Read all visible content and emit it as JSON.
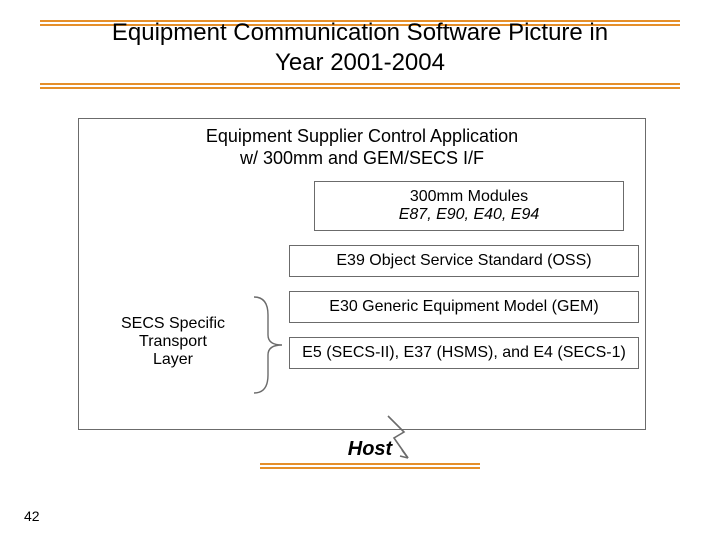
{
  "title": {
    "line1": "Equipment Communication Software Picture in",
    "line2": "Year 2001-2004"
  },
  "outer": {
    "supplier_line1": "Equipment Supplier Control Application",
    "supplier_line2": "w/ 300mm and GEM/SECS I/F",
    "modules_line1": "300mm Modules",
    "modules_line2": "E87, E90, E40, E94",
    "e39": "E39 Object Service Standard (OSS)",
    "e30": "E30 Generic Equipment Model (GEM)",
    "e5": "E5 (SECS-II), E37 (HSMS), and E4 (SECS-1)",
    "secs_line1": "SECS Specific",
    "secs_line2": "Transport",
    "secs_line3": "Layer"
  },
  "host": "Host",
  "page_number": "42",
  "colors": {
    "accent": "#e58f2a",
    "box_border": "#6b6b6b"
  }
}
